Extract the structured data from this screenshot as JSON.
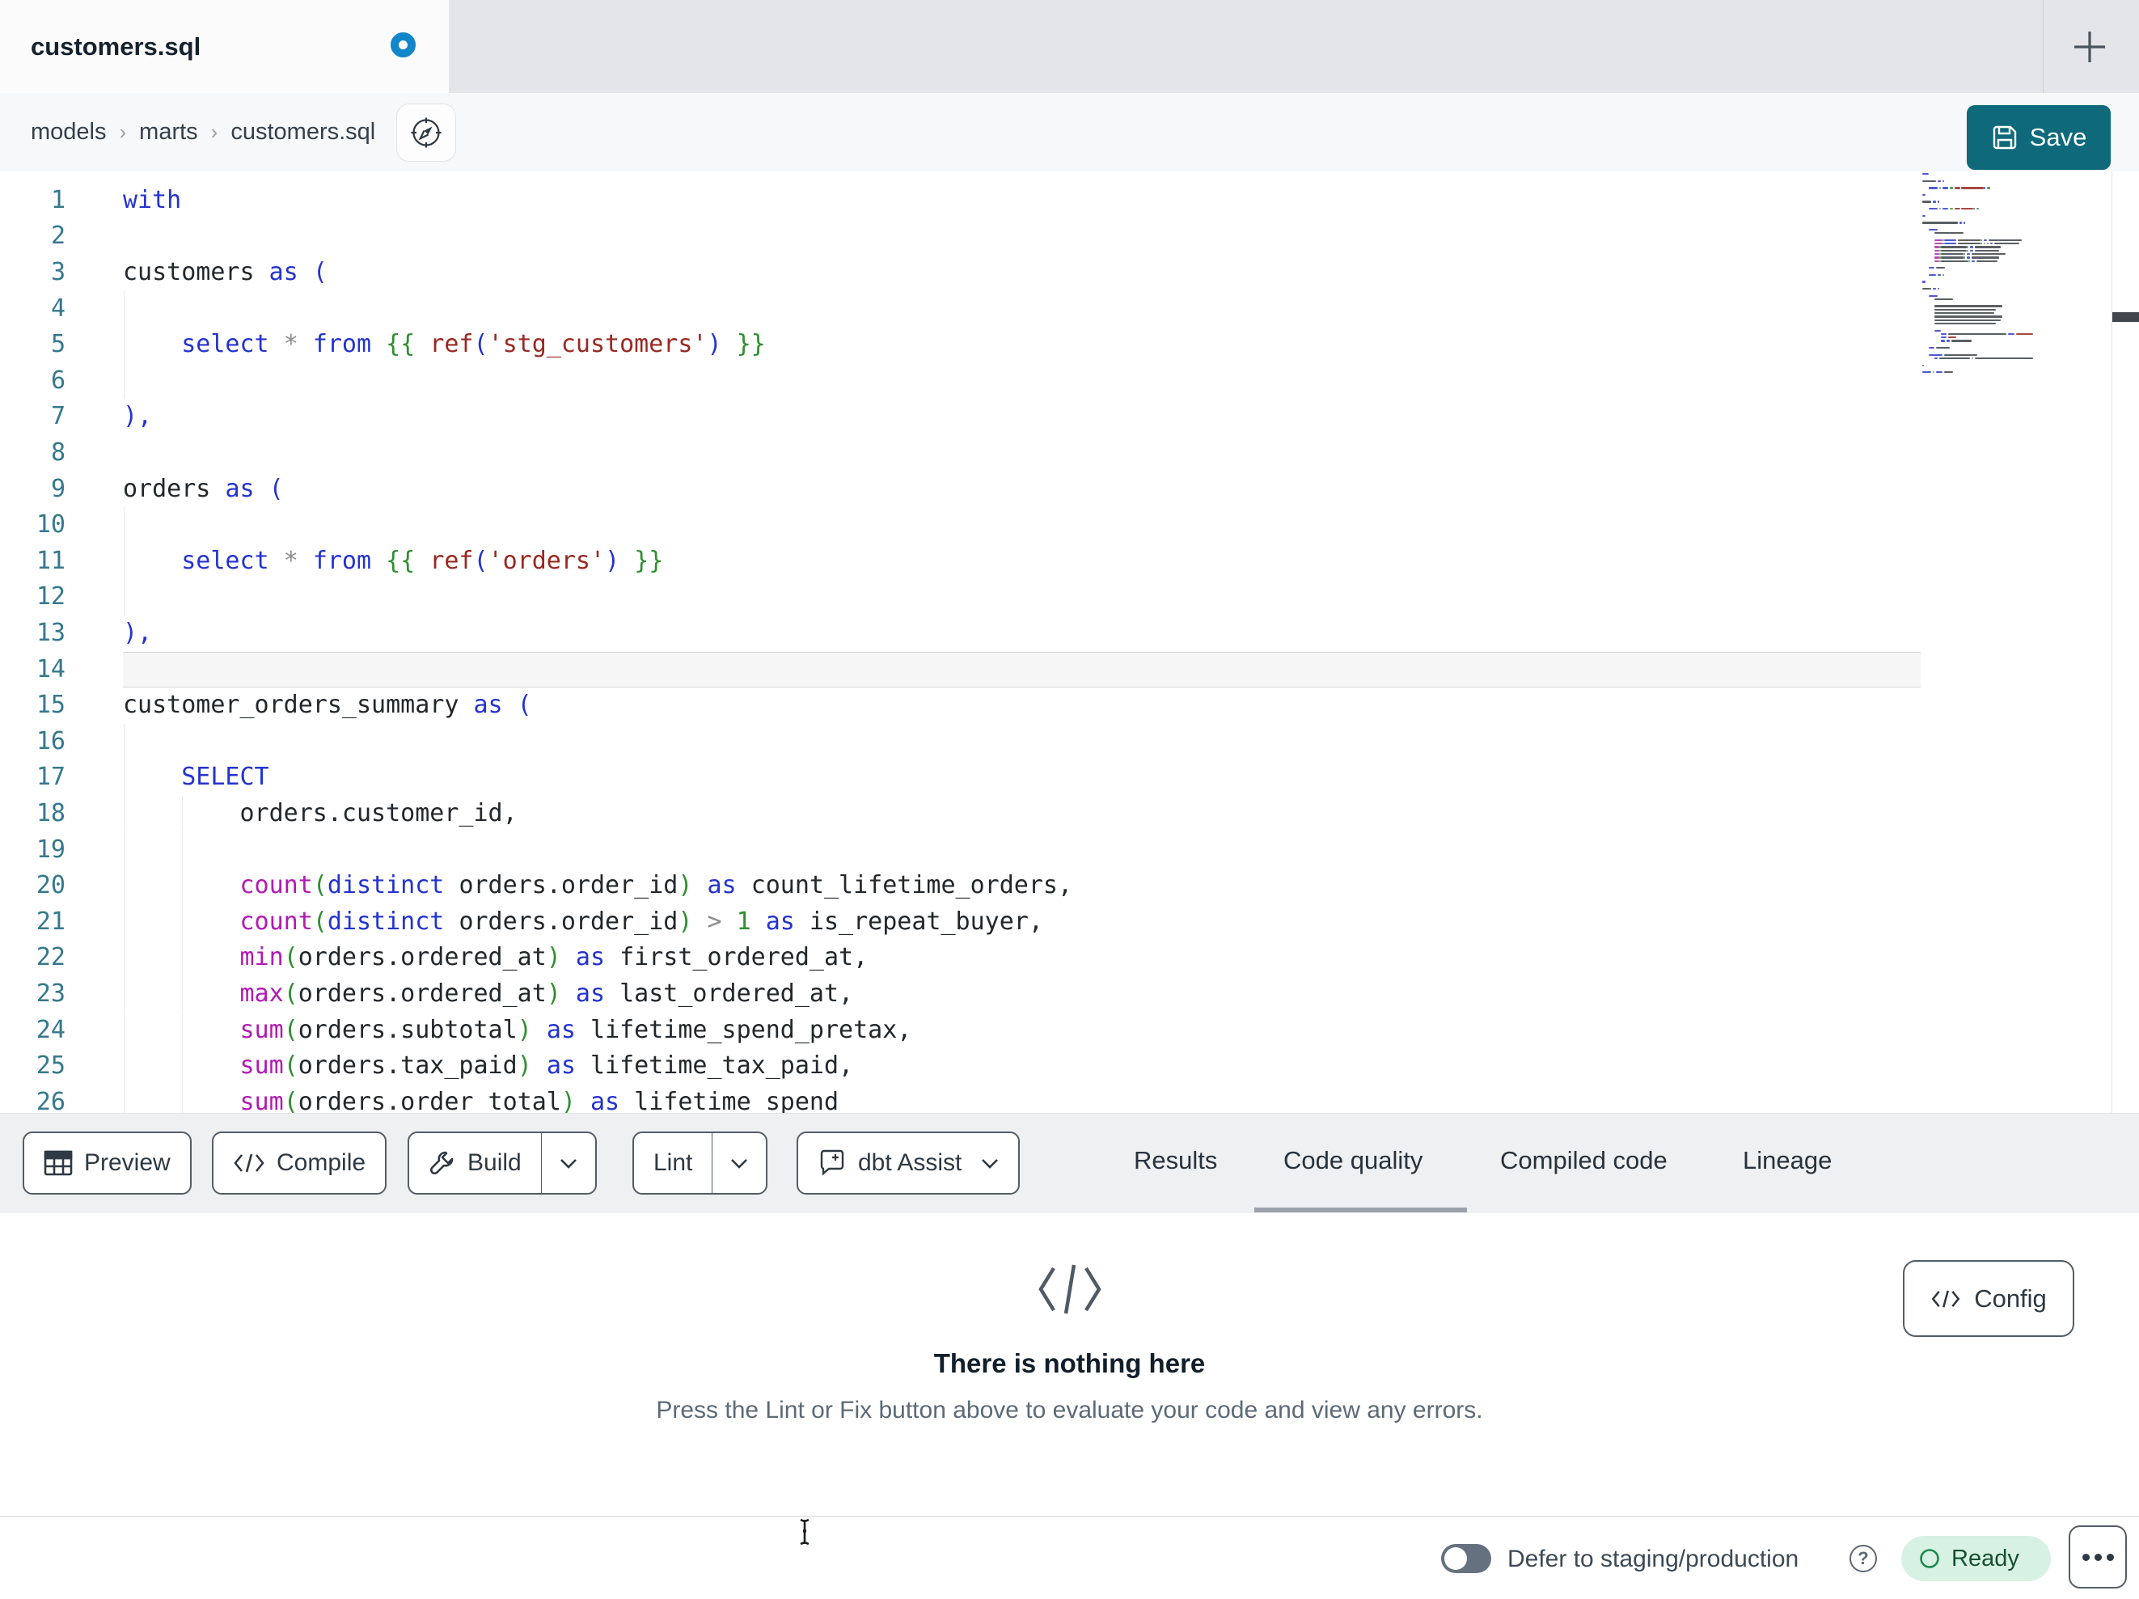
{
  "tab_bar": {
    "active_tab": "customers.sql",
    "unsaved": true,
    "new_tab_label": "+"
  },
  "breadcrumb": {
    "items": [
      "models",
      "marts",
      "customers.sql"
    ]
  },
  "actions": {
    "save_label": "Save"
  },
  "editor": {
    "language": "sql",
    "lines": [
      {
        "n": 1,
        "g": 0,
        "t": [
          [
            "with",
            "kw"
          ]
        ]
      },
      {
        "n": 2,
        "g": 0,
        "t": []
      },
      {
        "n": 3,
        "g": 0,
        "t": [
          [
            "customers",
            "id"
          ],
          [
            " ",
            "id"
          ],
          [
            "as",
            "kw"
          ],
          [
            " ",
            "id"
          ],
          [
            "(",
            "kw"
          ]
        ]
      },
      {
        "n": 4,
        "g": 1,
        "t": []
      },
      {
        "n": 5,
        "g": 1,
        "t": [
          [
            "    ",
            "id"
          ],
          [
            "select",
            "kw"
          ],
          [
            " ",
            "id"
          ],
          [
            "*",
            "op"
          ],
          [
            " ",
            "id"
          ],
          [
            "from",
            "kw"
          ],
          [
            " ",
            "id"
          ],
          [
            "{{",
            "grn"
          ],
          [
            " ",
            "id"
          ],
          [
            "ref",
            "str"
          ],
          [
            "(",
            "kw"
          ],
          [
            "'stg_customers'",
            "str"
          ],
          [
            ")",
            "kw"
          ],
          [
            " ",
            "id"
          ],
          [
            "}}",
            "grn"
          ]
        ]
      },
      {
        "n": 6,
        "g": 1,
        "t": []
      },
      {
        "n": 7,
        "g": 0,
        "t": [
          [
            "),",
            "kw"
          ]
        ]
      },
      {
        "n": 8,
        "g": 0,
        "t": []
      },
      {
        "n": 9,
        "g": 0,
        "t": [
          [
            "orders",
            "id"
          ],
          [
            " ",
            "id"
          ],
          [
            "as",
            "kw"
          ],
          [
            " ",
            "id"
          ],
          [
            "(",
            "kw"
          ]
        ]
      },
      {
        "n": 10,
        "g": 1,
        "t": []
      },
      {
        "n": 11,
        "g": 1,
        "t": [
          [
            "    ",
            "id"
          ],
          [
            "select",
            "kw"
          ],
          [
            " ",
            "id"
          ],
          [
            "*",
            "op"
          ],
          [
            " ",
            "id"
          ],
          [
            "from",
            "kw"
          ],
          [
            " ",
            "id"
          ],
          [
            "{{",
            "grn"
          ],
          [
            " ",
            "id"
          ],
          [
            "ref",
            "str"
          ],
          [
            "(",
            "kw"
          ],
          [
            "'orders'",
            "str"
          ],
          [
            ")",
            "kw"
          ],
          [
            " ",
            "id"
          ],
          [
            "}}",
            "grn"
          ]
        ]
      },
      {
        "n": 12,
        "g": 1,
        "t": []
      },
      {
        "n": 13,
        "g": 0,
        "t": [
          [
            "),",
            "kw"
          ]
        ]
      },
      {
        "n": 14,
        "g": 0,
        "active": true,
        "t": []
      },
      {
        "n": 15,
        "g": 0,
        "t": [
          [
            "customer_orders_summary",
            "id"
          ],
          [
            " ",
            "id"
          ],
          [
            "as",
            "kw"
          ],
          [
            " ",
            "id"
          ],
          [
            "(",
            "kw"
          ]
        ]
      },
      {
        "n": 16,
        "g": 1,
        "t": []
      },
      {
        "n": 17,
        "g": 1,
        "t": [
          [
            "    ",
            "id"
          ],
          [
            "SELECT",
            "kw"
          ]
        ]
      },
      {
        "n": 18,
        "g": 2,
        "t": [
          [
            "        ",
            "id"
          ],
          [
            "orders.customer_id,",
            "id"
          ]
        ]
      },
      {
        "n": 19,
        "g": 2,
        "t": []
      },
      {
        "n": 20,
        "g": 2,
        "t": [
          [
            "        ",
            "id"
          ],
          [
            "count",
            "fn"
          ],
          [
            "(",
            "grn"
          ],
          [
            "distinct",
            "kw"
          ],
          [
            " ",
            "id"
          ],
          [
            "orders.order_id",
            "id"
          ],
          [
            ")",
            "grn"
          ],
          [
            " ",
            "id"
          ],
          [
            "as",
            "kw"
          ],
          [
            " ",
            "id"
          ],
          [
            "count_lifetime_orders,",
            "id"
          ]
        ]
      },
      {
        "n": 21,
        "g": 2,
        "t": [
          [
            "        ",
            "id"
          ],
          [
            "count",
            "fn"
          ],
          [
            "(",
            "grn"
          ],
          [
            "distinct",
            "kw"
          ],
          [
            " ",
            "id"
          ],
          [
            "orders.order_id",
            "id"
          ],
          [
            ")",
            "grn"
          ],
          [
            " ",
            "id"
          ],
          [
            ">",
            "op"
          ],
          [
            " ",
            "id"
          ],
          [
            "1",
            "grn"
          ],
          [
            " ",
            "id"
          ],
          [
            "as",
            "kw"
          ],
          [
            " ",
            "id"
          ],
          [
            "is_repeat_buyer,",
            "id"
          ]
        ]
      },
      {
        "n": 22,
        "g": 2,
        "t": [
          [
            "        ",
            "id"
          ],
          [
            "min",
            "fn"
          ],
          [
            "(",
            "grn"
          ],
          [
            "orders.ordered_at",
            "id"
          ],
          [
            ")",
            "grn"
          ],
          [
            " ",
            "id"
          ],
          [
            "as",
            "kw"
          ],
          [
            " ",
            "id"
          ],
          [
            "first_ordered_at,",
            "id"
          ]
        ]
      },
      {
        "n": 23,
        "g": 2,
        "t": [
          [
            "        ",
            "id"
          ],
          [
            "max",
            "fn"
          ],
          [
            "(",
            "grn"
          ],
          [
            "orders.ordered_at",
            "id"
          ],
          [
            ")",
            "grn"
          ],
          [
            " ",
            "id"
          ],
          [
            "as",
            "kw"
          ],
          [
            " ",
            "id"
          ],
          [
            "last_ordered_at,",
            "id"
          ]
        ]
      },
      {
        "n": 24,
        "g": 2,
        "t": [
          [
            "        ",
            "id"
          ],
          [
            "sum",
            "fn"
          ],
          [
            "(",
            "grn"
          ],
          [
            "orders.subtotal",
            "id"
          ],
          [
            ")",
            "grn"
          ],
          [
            " ",
            "id"
          ],
          [
            "as",
            "kw"
          ],
          [
            " ",
            "id"
          ],
          [
            "lifetime_spend_pretax,",
            "id"
          ]
        ]
      },
      {
        "n": 25,
        "g": 2,
        "t": [
          [
            "        ",
            "id"
          ],
          [
            "sum",
            "fn"
          ],
          [
            "(",
            "grn"
          ],
          [
            "orders.tax_paid",
            "id"
          ],
          [
            ")",
            "grn"
          ],
          [
            " ",
            "id"
          ],
          [
            "as",
            "kw"
          ],
          [
            " ",
            "id"
          ],
          [
            "lifetime_tax_paid,",
            "id"
          ]
        ]
      },
      {
        "n": 26,
        "g": 2,
        "t": [
          [
            "        ",
            "id"
          ],
          [
            "sum",
            "fn"
          ],
          [
            "(",
            "grn"
          ],
          [
            "orders.order_total",
            "id"
          ],
          [
            ")",
            "grn"
          ],
          [
            " ",
            "id"
          ],
          [
            "as",
            "kw"
          ],
          [
            " ",
            "id"
          ],
          [
            "lifetime_spend",
            "id"
          ]
        ]
      }
    ]
  },
  "toolbar": {
    "preview_label": "Preview",
    "compile_label": "Compile",
    "build_label": "Build",
    "lint_label": "Lint",
    "assist_label": "dbt Assist"
  },
  "panel_tabs": {
    "items": [
      {
        "label": "Results",
        "active": false
      },
      {
        "label": "Code quality",
        "active": true
      },
      {
        "label": "Compiled code",
        "active": false
      },
      {
        "label": "Lineage",
        "active": false
      }
    ]
  },
  "panel": {
    "empty": {
      "title": "There is nothing here",
      "description": "Press the Lint or Fix button above to evaluate your code and view any errors."
    },
    "config_label": "Config"
  },
  "statusbar": {
    "defer_label": "Defer to staging/production",
    "defer_toggle_on": false,
    "ready_label": "Ready"
  },
  "colors": {
    "save_teal": "#0e6a7a",
    "unsaved_dot_blue": "#1286c8",
    "ready_badge_bg": "#d7f2e2",
    "ready_green": "#1d8a50",
    "keyword_blue": "#2433cf",
    "function_magenta": "#b21ab2",
    "string_red": "#9a2822",
    "bracket_green": "#2e8f2e",
    "line_number_teal": "#35788e",
    "tab_underline_gray": "#9ba1ab"
  }
}
